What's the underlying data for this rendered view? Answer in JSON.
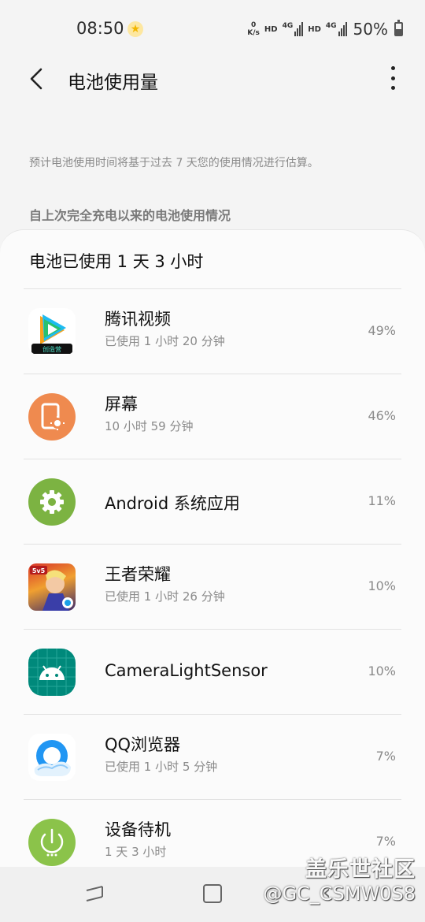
{
  "status_bar": {
    "time": "08:50",
    "net_speed_value": "0",
    "net_speed_unit": "K/s",
    "hd1": "HD",
    "net1": "4G",
    "hd2": "HD",
    "net2": "4G",
    "battery_pct": "50%",
    "battery_level": 0.5
  },
  "header": {
    "title": "电池使用量"
  },
  "note": "预计电池使用时间将基于过去 7 天您的使用情况进行估算。",
  "section_label": "自上次完全充电以来的电池使用情况",
  "card": {
    "title": "电池已使用 1 天 3 小时",
    "apps": [
      {
        "name": "腾讯视频",
        "sub": "已使用 1 小时 20 分钟",
        "pct": "49%",
        "icon": "tencent-video-icon",
        "icon_badge": "创造营"
      },
      {
        "name": "屏幕",
        "sub": "10 小时 59 分钟",
        "pct": "46%",
        "icon": "screen-icon"
      },
      {
        "name": "Android 系统应用",
        "sub": "",
        "pct": "11%",
        "icon": "gear-icon"
      },
      {
        "name": "王者荣耀",
        "sub": "已使用 1 小时 26 分钟",
        "pct": "10%",
        "icon": "honor-of-kings-icon",
        "icon_badge": "5v5"
      },
      {
        "name": "CameraLightSensor",
        "sub": "",
        "pct": "10%",
        "icon": "android-icon"
      },
      {
        "name": "QQ浏览器",
        "sub": "已使用 1 小时 5 分钟",
        "pct": "7%",
        "icon": "qq-browser-icon"
      },
      {
        "name": "设备待机",
        "sub": "1 天 3 小时",
        "pct": "7%",
        "icon": "power-icon"
      }
    ]
  },
  "watermark": {
    "line1": "盖乐世社区",
    "line2": "@GC_CSMW0S8"
  },
  "colors": {
    "screen_icon_bg": "#ef8a4f",
    "android_icon_bg": "#7cb342",
    "camera_icon_bg": "#00897b",
    "standby_icon_bg": "#8bc34a"
  }
}
